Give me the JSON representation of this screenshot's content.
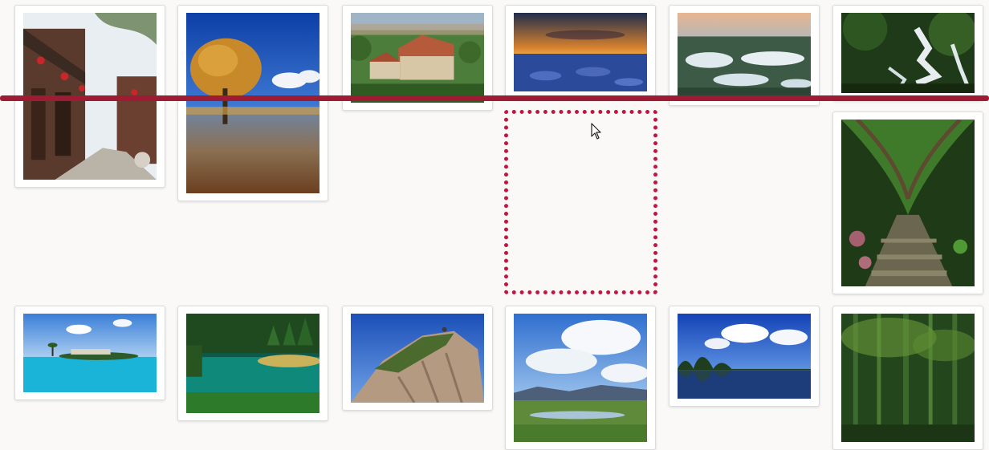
{
  "gallery": {
    "photos": [
      {
        "id": "p1",
        "subject": "old-town-street-photo"
      },
      {
        "id": "p2",
        "subject": "autumn-tree-lake-photo"
      },
      {
        "id": "p3",
        "subject": "castle-villa-photo"
      },
      {
        "id": "p4",
        "subject": "sunset-snowfield-photo"
      },
      {
        "id": "p5",
        "subject": "snowy-wetland-photo"
      },
      {
        "id": "p6",
        "subject": "forest-waterfall-photo"
      },
      {
        "id": "p7",
        "subject": "forest-path-photo"
      },
      {
        "id": "p8",
        "subject": "tropical-island-photo"
      },
      {
        "id": "p9",
        "subject": "emerald-lake-photo"
      },
      {
        "id": "p10",
        "subject": "granite-cliff-photo"
      },
      {
        "id": "p11",
        "subject": "cloudy-grassland-photo"
      },
      {
        "id": "p12",
        "subject": "karst-mountains-lake-photo"
      },
      {
        "id": "p13",
        "subject": "bamboo-forest-photo"
      }
    ]
  },
  "placeholder": {
    "state": "empty-drop-target",
    "color": "#c0163f"
  },
  "divider": {
    "color": "#9e1c33"
  },
  "cursor": {
    "icon": "arrow-cursor-icon"
  }
}
